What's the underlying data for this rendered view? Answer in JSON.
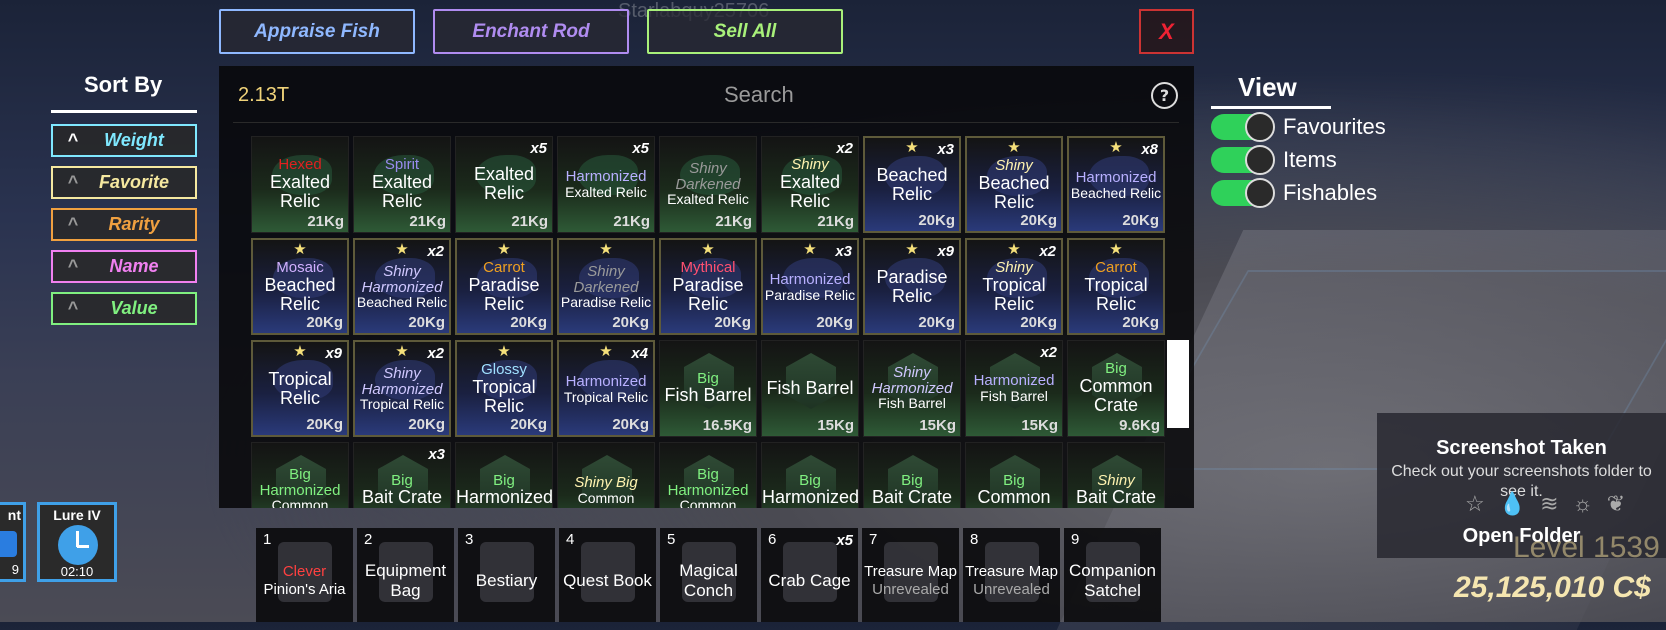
{
  "username": "Starlabquy25706",
  "top_buttons": [
    {
      "label": "Appraise Fish",
      "color": "#8fb8ff"
    },
    {
      "label": "Enchant Rod",
      "color": "#b08cf0"
    },
    {
      "label": "Sell All",
      "color": "#a8f07a"
    }
  ],
  "close_label": "X",
  "money": "2.13T",
  "search_placeholder": "Search",
  "help_label": "?",
  "sort": {
    "title": "Sort By",
    "options": [
      {
        "label": "Weight",
        "color": "#7fe8ff"
      },
      {
        "label": "Favorite",
        "color": "#f5e8a0"
      },
      {
        "label": "Rarity",
        "color": "#f0a040"
      },
      {
        "label": "Name",
        "color": "#f080f0"
      },
      {
        "label": "Value",
        "color": "#80f080"
      }
    ]
  },
  "view": {
    "title": "View",
    "toggles": [
      {
        "label": "Favourites",
        "on": true
      },
      {
        "label": "Items",
        "on": true
      },
      {
        "label": "Fishables",
        "on": true
      }
    ]
  },
  "items": [
    {
      "prefix": "Hexed",
      "prefix_color": "#e02020",
      "name": "Exalted Relic",
      "count": "",
      "weight": "21Kg",
      "fav": false
    },
    {
      "prefix": "Spirit",
      "prefix_color": "#9a8cf0",
      "name": "Exalted Relic",
      "count": "",
      "weight": "21Kg",
      "fav": false
    },
    {
      "prefix": "",
      "prefix_color": "#ffffff",
      "name": "Exalted Relic",
      "count": "x5",
      "weight": "21Kg",
      "fav": false
    },
    {
      "prefix": "Harmonized",
      "prefix_color": "#b8b0ff",
      "name": "Exalted Relic",
      "count": "x5",
      "weight": "21Kg",
      "fav": false
    },
    {
      "prefix": "Shiny Darkened",
      "prefix_color": "#9a9a9a",
      "name": "Exalted Relic",
      "count": "",
      "weight": "21Kg",
      "fav": false
    },
    {
      "prefix": "Shiny",
      "prefix_color": "#fff3b0",
      "name": "Exalted Relic",
      "count": "x2",
      "weight": "21Kg",
      "fav": false
    },
    {
      "prefix": "",
      "prefix_color": "#ffffff",
      "name": "Beached Relic",
      "count": "x3",
      "weight": "20Kg",
      "fav": true
    },
    {
      "prefix": "Shiny",
      "prefix_color": "#fff3b0",
      "name": "Beached Relic",
      "count": "",
      "weight": "20Kg",
      "fav": true
    },
    {
      "prefix": "Harmonized",
      "prefix_color": "#b8b0ff",
      "name": "Beached Relic",
      "count": "x8",
      "weight": "20Kg",
      "fav": true
    },
    {
      "prefix": "Mosaic",
      "prefix_color": "#d0b0ff",
      "name": "Beached Relic",
      "count": "",
      "weight": "20Kg",
      "fav": true
    },
    {
      "prefix": "Shiny Harmonized",
      "prefix_color": "#d0c8ff",
      "name": "Beached Relic",
      "count": "x2",
      "weight": "20Kg",
      "fav": true
    },
    {
      "prefix": "Carrot",
      "prefix_color": "#f0a020",
      "name": "Paradise Relic",
      "count": "",
      "weight": "20Kg",
      "fav": true
    },
    {
      "prefix": "Shiny Darkened",
      "prefix_color": "#9a9a9a",
      "name": "Paradise Relic",
      "count": "",
      "weight": "20Kg",
      "fav": true
    },
    {
      "prefix": "Mythical",
      "prefix_color": "#ff5070",
      "name": "Paradise Relic",
      "count": "",
      "weight": "20Kg",
      "fav": true
    },
    {
      "prefix": "Harmonized",
      "prefix_color": "#b8b0ff",
      "name": "Paradise Relic",
      "count": "x3",
      "weight": "20Kg",
      "fav": true
    },
    {
      "prefix": "",
      "prefix_color": "#ffffff",
      "name": "Paradise Relic",
      "count": "x9",
      "weight": "20Kg",
      "fav": true
    },
    {
      "prefix": "Shiny",
      "prefix_color": "#fff3b0",
      "name": "Tropical Relic",
      "count": "x2",
      "weight": "20Kg",
      "fav": true
    },
    {
      "prefix": "Carrot",
      "prefix_color": "#f0a020",
      "name": "Tropical Relic",
      "count": "",
      "weight": "20Kg",
      "fav": true
    },
    {
      "prefix": "",
      "prefix_color": "#ffffff",
      "name": "Tropical Relic",
      "count": "x9",
      "weight": "20Kg",
      "fav": true
    },
    {
      "prefix": "Shiny Harmonized",
      "prefix_color": "#d0c8ff",
      "name": "Tropical Relic",
      "count": "x2",
      "weight": "20Kg",
      "fav": true
    },
    {
      "prefix": "Glossy",
      "prefix_color": "#a0e0ff",
      "name": "Tropical Relic",
      "count": "",
      "weight": "20Kg",
      "fav": true
    },
    {
      "prefix": "Harmonized",
      "prefix_color": "#b8b0ff",
      "name": "Tropical Relic",
      "count": "x4",
      "weight": "20Kg",
      "fav": true
    },
    {
      "prefix": "Big",
      "prefix_color": "#80f080",
      "name": "Fish Barrel",
      "count": "",
      "weight": "16.5Kg",
      "fav": false
    },
    {
      "prefix": "",
      "prefix_color": "#ffffff",
      "name": "Fish Barrel",
      "count": "",
      "weight": "15Kg",
      "fav": false
    },
    {
      "prefix": "Shiny Harmonized",
      "prefix_color": "#d0c8ff",
      "name": "Fish Barrel",
      "count": "",
      "weight": "15Kg",
      "fav": false
    },
    {
      "prefix": "Harmonized",
      "prefix_color": "#b8b0ff",
      "name": "Fish Barrel",
      "count": "x2",
      "weight": "15Kg",
      "fav": false
    },
    {
      "prefix": "Big",
      "prefix_color": "#80f080",
      "name": "Common Crate",
      "count": "",
      "weight": "9.6Kg",
      "fav": false
    },
    {
      "prefix": "Big Harmonized",
      "prefix_color": "#80f080",
      "name": "Common",
      "count": "",
      "weight": "",
      "fav": false
    },
    {
      "prefix": "Big",
      "prefix_color": "#80f080",
      "name": "Bait Crate",
      "count": "x3",
      "weight": "",
      "fav": false
    },
    {
      "prefix": "Big",
      "prefix_color": "#80f080",
      "name": "Harmonized",
      "count": "",
      "weight": "",
      "fav": false
    },
    {
      "prefix": "Shiny Big",
      "prefix_color": "#fff3b0",
      "name": "Common",
      "count": "",
      "weight": "",
      "fav": false
    },
    {
      "prefix": "Big Harmonized",
      "prefix_color": "#80f080",
      "name": "Common",
      "count": "",
      "weight": "",
      "fav": false
    },
    {
      "prefix": "Big",
      "prefix_color": "#80f080",
      "name": "Harmonized",
      "count": "",
      "weight": "",
      "fav": false
    },
    {
      "prefix": "Big",
      "prefix_color": "#80f080",
      "name": "Bait Crate",
      "count": "",
      "weight": "",
      "fav": false
    },
    {
      "prefix": "Big",
      "prefix_color": "#80f080",
      "name": "Common",
      "count": "",
      "weight": "",
      "fav": false
    },
    {
      "prefix": "Shiny",
      "prefix_color": "#fff3b0",
      "name": "Bait Crate",
      "count": "",
      "weight": "",
      "fav": false
    }
  ],
  "hotbar": [
    {
      "num": "1",
      "prefix": "Clever",
      "prefix_color": "#ff4040",
      "label": "Pinion's Aria",
      "sub": "",
      "count": ""
    },
    {
      "num": "2",
      "prefix": "",
      "prefix_color": "#ffffff",
      "label": "Equipment Bag",
      "sub": "",
      "count": ""
    },
    {
      "num": "3",
      "prefix": "",
      "prefix_color": "#ffffff",
      "label": "Bestiary",
      "sub": "",
      "count": ""
    },
    {
      "num": "4",
      "prefix": "",
      "prefix_color": "#ffffff",
      "label": "Quest Book",
      "sub": "",
      "count": ""
    },
    {
      "num": "5",
      "prefix": "",
      "prefix_color": "#ffffff",
      "label": "Magical Conch",
      "sub": "",
      "count": ""
    },
    {
      "num": "6",
      "prefix": "",
      "prefix_color": "#ffffff",
      "label": "Crab Cage",
      "sub": "",
      "count": "x5"
    },
    {
      "num": "7",
      "prefix": "",
      "prefix_color": "#ffffff",
      "label": "Treasure Map",
      "sub": "Unrevealed",
      "count": ""
    },
    {
      "num": "8",
      "prefix": "",
      "prefix_color": "#ffffff",
      "label": "Treasure Map",
      "sub": "Unrevealed",
      "count": ""
    },
    {
      "num": "9",
      "prefix": "",
      "prefix_color": "#ffffff",
      "label": "Companion Satchel",
      "sub": "",
      "count": ""
    }
  ],
  "boosts": [
    {
      "label": "nt",
      "timer": "9"
    },
    {
      "label": "Lure IV",
      "timer": "02:10"
    }
  ],
  "notification": {
    "title": "Screenshot Taken",
    "message": "Check out your screenshots folder to see it.",
    "button": "Open Folder"
  },
  "level": "Level 1539",
  "coins": "25,125,010 C$"
}
